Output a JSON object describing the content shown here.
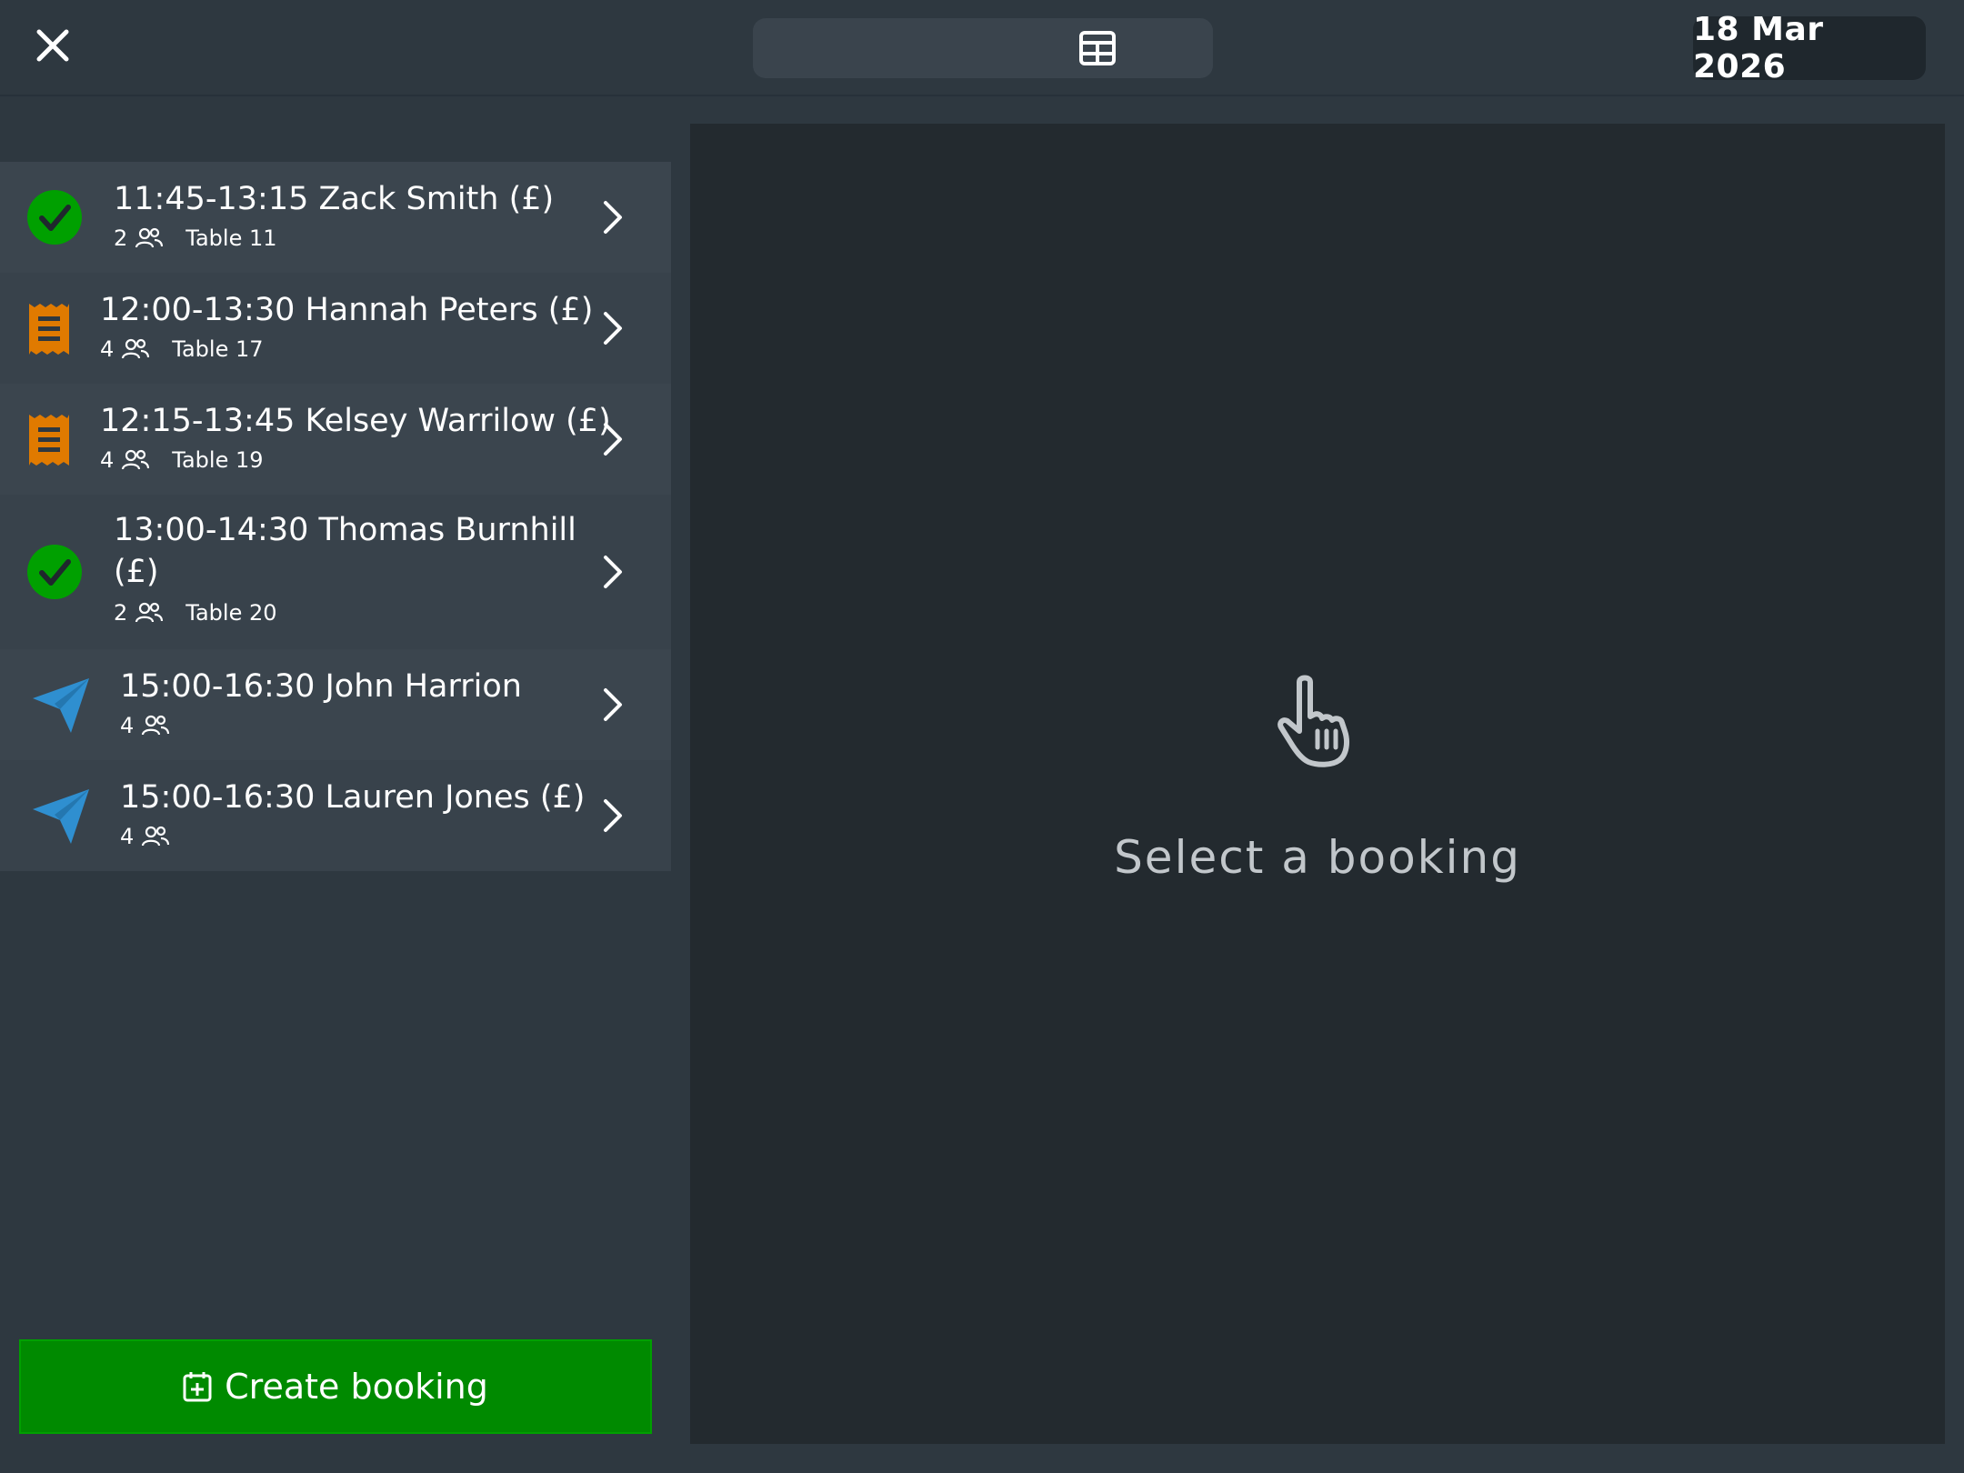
{
  "header": {
    "close_icon": "close-icon",
    "view_toggle": [
      {
        "icon": "list-icon",
        "selected": true
      },
      {
        "icon": "grid-icon",
        "selected": false
      }
    ],
    "date": "18 Mar 2026"
  },
  "colors": {
    "confirmed": "#00a000",
    "pending": "#e07a00",
    "sent": "#2f8fd0",
    "create_button": "#008a00"
  },
  "bookings": [
    {
      "status": "confirmed",
      "icon": "check-circle-icon",
      "title": "11:45-13:15 Zack Smith (£)",
      "guests": "2",
      "table": "Table 11"
    },
    {
      "status": "pending",
      "icon": "receipt-icon",
      "title": "12:00-13:30 Hannah Peters (£)",
      "guests": "4",
      "table": "Table 17"
    },
    {
      "status": "pending",
      "icon": "receipt-icon",
      "title": "12:15-13:45 Kelsey Warrilow (£)",
      "guests": "4",
      "table": "Table 19"
    },
    {
      "status": "confirmed",
      "icon": "check-circle-icon",
      "title_line1": "13:00-14:30 Thomas Burnhill",
      "title_line2": "(£)",
      "guests": "2",
      "table": "Table 20"
    },
    {
      "status": "sent",
      "icon": "paper-plane-icon",
      "title": "15:00-16:30 John Harrion",
      "guests": "4",
      "table": ""
    },
    {
      "status": "sent",
      "icon": "paper-plane-icon",
      "title": "15:00-16:30 Lauren Jones (£)",
      "guests": "4",
      "table": ""
    }
  ],
  "detail": {
    "icon": "pointing-hand-icon",
    "placeholder": "Select a booking"
  },
  "create_button": {
    "icon": "calendar-plus-icon",
    "label": "Create booking"
  }
}
